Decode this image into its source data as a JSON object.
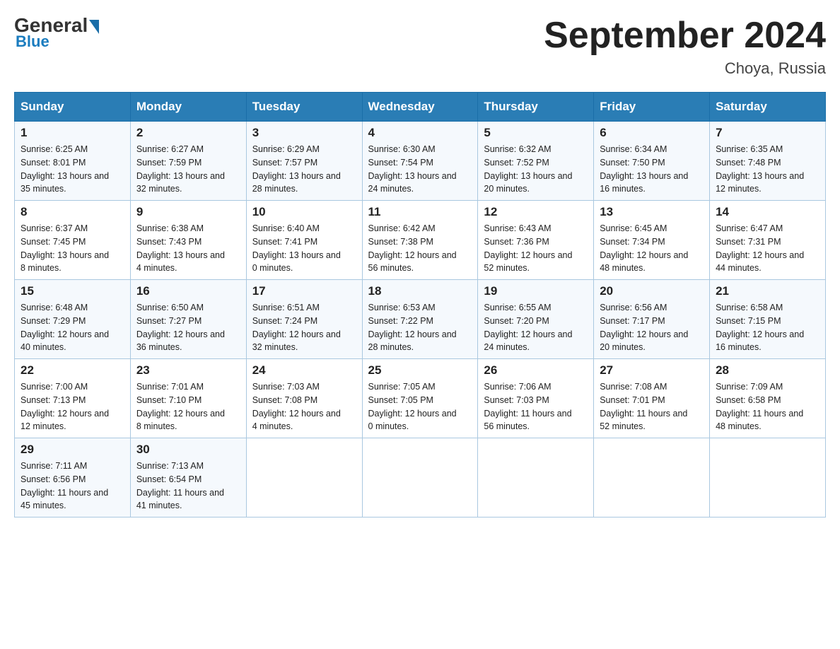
{
  "header": {
    "logo_general": "General",
    "logo_blue": "Blue",
    "month_title": "September 2024",
    "location": "Choya, Russia"
  },
  "days_of_week": [
    "Sunday",
    "Monday",
    "Tuesday",
    "Wednesday",
    "Thursday",
    "Friday",
    "Saturday"
  ],
  "weeks": [
    [
      {
        "day": "1",
        "sunrise": "Sunrise: 6:25 AM",
        "sunset": "Sunset: 8:01 PM",
        "daylight": "Daylight: 13 hours and 35 minutes."
      },
      {
        "day": "2",
        "sunrise": "Sunrise: 6:27 AM",
        "sunset": "Sunset: 7:59 PM",
        "daylight": "Daylight: 13 hours and 32 minutes."
      },
      {
        "day": "3",
        "sunrise": "Sunrise: 6:29 AM",
        "sunset": "Sunset: 7:57 PM",
        "daylight": "Daylight: 13 hours and 28 minutes."
      },
      {
        "day": "4",
        "sunrise": "Sunrise: 6:30 AM",
        "sunset": "Sunset: 7:54 PM",
        "daylight": "Daylight: 13 hours and 24 minutes."
      },
      {
        "day": "5",
        "sunrise": "Sunrise: 6:32 AM",
        "sunset": "Sunset: 7:52 PM",
        "daylight": "Daylight: 13 hours and 20 minutes."
      },
      {
        "day": "6",
        "sunrise": "Sunrise: 6:34 AM",
        "sunset": "Sunset: 7:50 PM",
        "daylight": "Daylight: 13 hours and 16 minutes."
      },
      {
        "day": "7",
        "sunrise": "Sunrise: 6:35 AM",
        "sunset": "Sunset: 7:48 PM",
        "daylight": "Daylight: 13 hours and 12 minutes."
      }
    ],
    [
      {
        "day": "8",
        "sunrise": "Sunrise: 6:37 AM",
        "sunset": "Sunset: 7:45 PM",
        "daylight": "Daylight: 13 hours and 8 minutes."
      },
      {
        "day": "9",
        "sunrise": "Sunrise: 6:38 AM",
        "sunset": "Sunset: 7:43 PM",
        "daylight": "Daylight: 13 hours and 4 minutes."
      },
      {
        "day": "10",
        "sunrise": "Sunrise: 6:40 AM",
        "sunset": "Sunset: 7:41 PM",
        "daylight": "Daylight: 13 hours and 0 minutes."
      },
      {
        "day": "11",
        "sunrise": "Sunrise: 6:42 AM",
        "sunset": "Sunset: 7:38 PM",
        "daylight": "Daylight: 12 hours and 56 minutes."
      },
      {
        "day": "12",
        "sunrise": "Sunrise: 6:43 AM",
        "sunset": "Sunset: 7:36 PM",
        "daylight": "Daylight: 12 hours and 52 minutes."
      },
      {
        "day": "13",
        "sunrise": "Sunrise: 6:45 AM",
        "sunset": "Sunset: 7:34 PM",
        "daylight": "Daylight: 12 hours and 48 minutes."
      },
      {
        "day": "14",
        "sunrise": "Sunrise: 6:47 AM",
        "sunset": "Sunset: 7:31 PM",
        "daylight": "Daylight: 12 hours and 44 minutes."
      }
    ],
    [
      {
        "day": "15",
        "sunrise": "Sunrise: 6:48 AM",
        "sunset": "Sunset: 7:29 PM",
        "daylight": "Daylight: 12 hours and 40 minutes."
      },
      {
        "day": "16",
        "sunrise": "Sunrise: 6:50 AM",
        "sunset": "Sunset: 7:27 PM",
        "daylight": "Daylight: 12 hours and 36 minutes."
      },
      {
        "day": "17",
        "sunrise": "Sunrise: 6:51 AM",
        "sunset": "Sunset: 7:24 PM",
        "daylight": "Daylight: 12 hours and 32 minutes."
      },
      {
        "day": "18",
        "sunrise": "Sunrise: 6:53 AM",
        "sunset": "Sunset: 7:22 PM",
        "daylight": "Daylight: 12 hours and 28 minutes."
      },
      {
        "day": "19",
        "sunrise": "Sunrise: 6:55 AM",
        "sunset": "Sunset: 7:20 PM",
        "daylight": "Daylight: 12 hours and 24 minutes."
      },
      {
        "day": "20",
        "sunrise": "Sunrise: 6:56 AM",
        "sunset": "Sunset: 7:17 PM",
        "daylight": "Daylight: 12 hours and 20 minutes."
      },
      {
        "day": "21",
        "sunrise": "Sunrise: 6:58 AM",
        "sunset": "Sunset: 7:15 PM",
        "daylight": "Daylight: 12 hours and 16 minutes."
      }
    ],
    [
      {
        "day": "22",
        "sunrise": "Sunrise: 7:00 AM",
        "sunset": "Sunset: 7:13 PM",
        "daylight": "Daylight: 12 hours and 12 minutes."
      },
      {
        "day": "23",
        "sunrise": "Sunrise: 7:01 AM",
        "sunset": "Sunset: 7:10 PM",
        "daylight": "Daylight: 12 hours and 8 minutes."
      },
      {
        "day": "24",
        "sunrise": "Sunrise: 7:03 AM",
        "sunset": "Sunset: 7:08 PM",
        "daylight": "Daylight: 12 hours and 4 minutes."
      },
      {
        "day": "25",
        "sunrise": "Sunrise: 7:05 AM",
        "sunset": "Sunset: 7:05 PM",
        "daylight": "Daylight: 12 hours and 0 minutes."
      },
      {
        "day": "26",
        "sunrise": "Sunrise: 7:06 AM",
        "sunset": "Sunset: 7:03 PM",
        "daylight": "Daylight: 11 hours and 56 minutes."
      },
      {
        "day": "27",
        "sunrise": "Sunrise: 7:08 AM",
        "sunset": "Sunset: 7:01 PM",
        "daylight": "Daylight: 11 hours and 52 minutes."
      },
      {
        "day": "28",
        "sunrise": "Sunrise: 7:09 AM",
        "sunset": "Sunset: 6:58 PM",
        "daylight": "Daylight: 11 hours and 48 minutes."
      }
    ],
    [
      {
        "day": "29",
        "sunrise": "Sunrise: 7:11 AM",
        "sunset": "Sunset: 6:56 PM",
        "daylight": "Daylight: 11 hours and 45 minutes."
      },
      {
        "day": "30",
        "sunrise": "Sunrise: 7:13 AM",
        "sunset": "Sunset: 6:54 PM",
        "daylight": "Daylight: 11 hours and 41 minutes."
      },
      null,
      null,
      null,
      null,
      null
    ]
  ]
}
